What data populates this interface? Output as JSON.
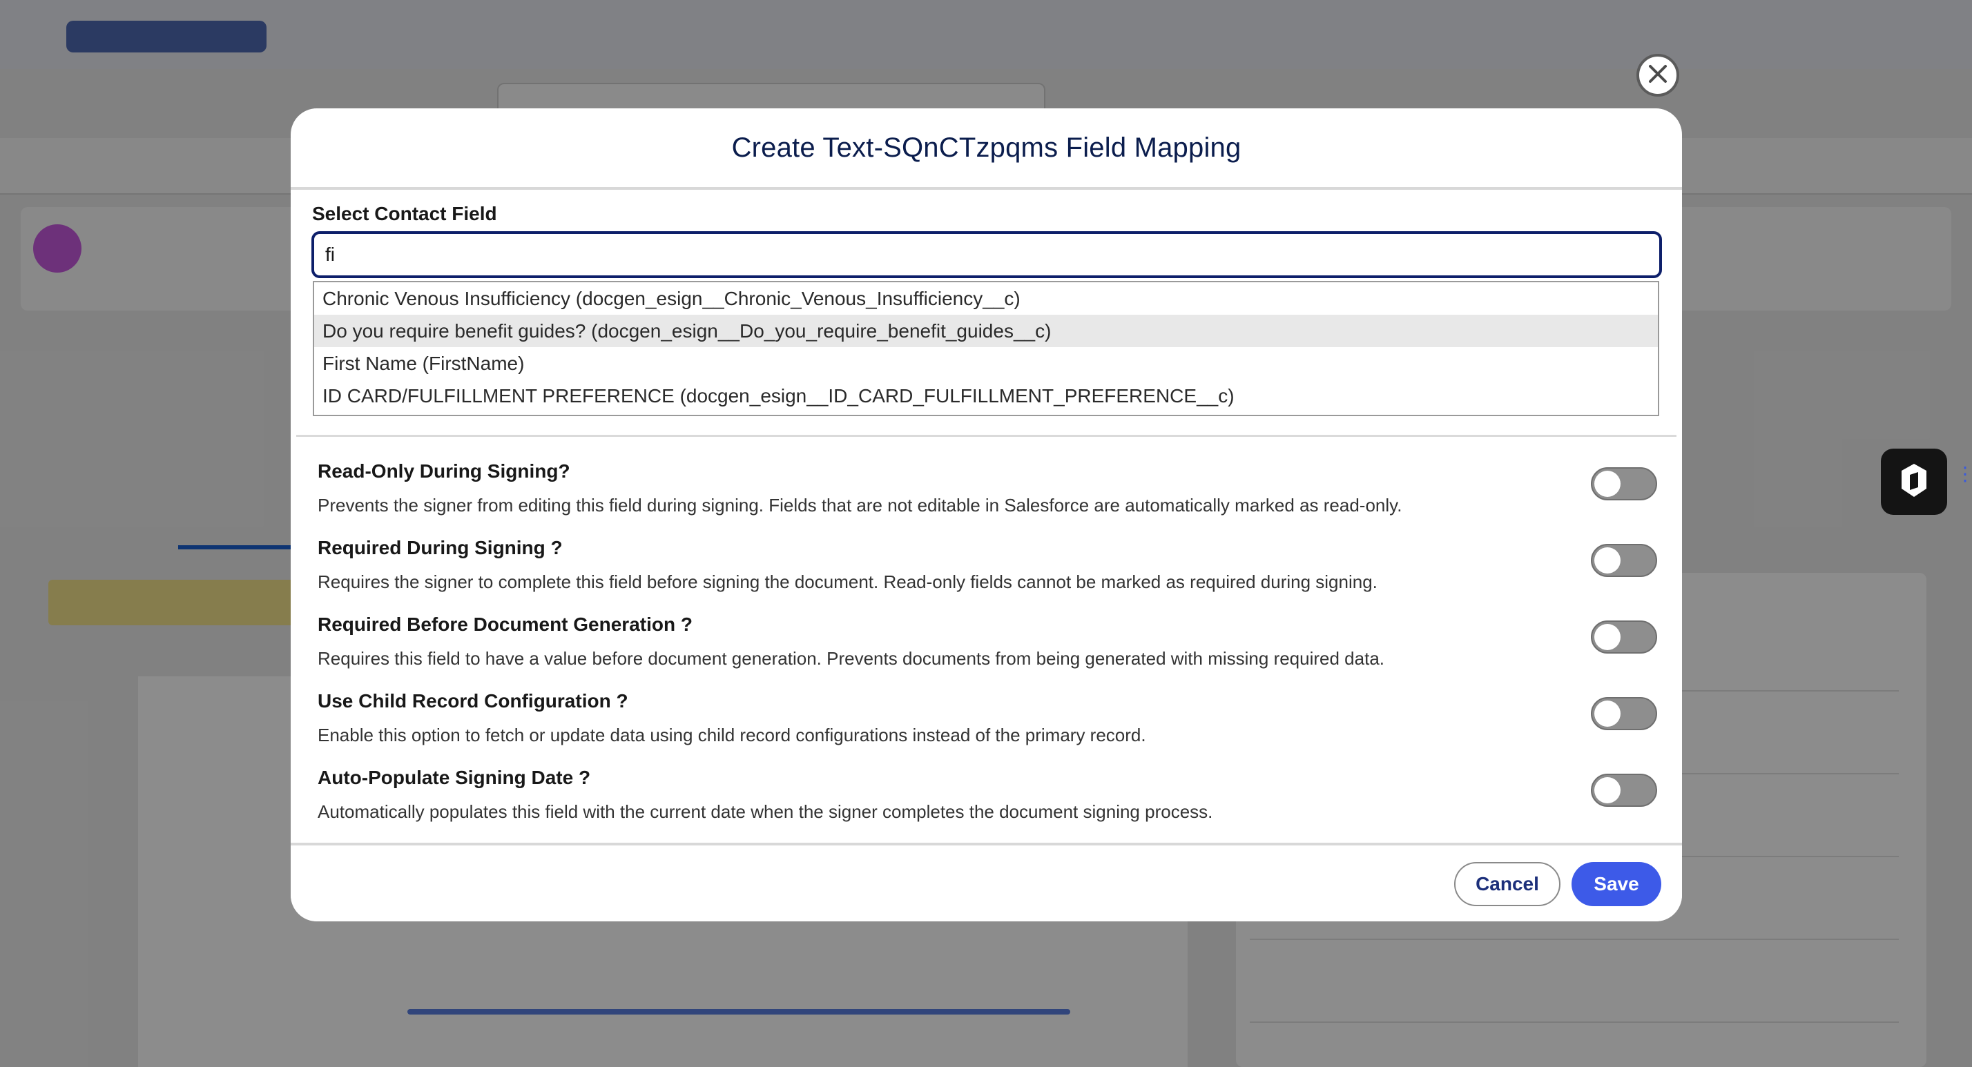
{
  "modal": {
    "title": "Create Text-SQnCTzpqms Field Mapping",
    "field_label": "Select Contact Field",
    "search_value": "fi",
    "dropdown_options": [
      "Chronic Venous Insufficiency (docgen_esign__Chronic_Venous_Insufficiency__c)",
      "Do you require benefit guides? (docgen_esign__Do_you_require_benefit_guides__c)",
      "First Name (FirstName)",
      "ID CARD/FULFILLMENT PREFERENCE (docgen_esign__ID_CARD_FULFILLMENT_PREFERENCE__c)"
    ],
    "highlighted_option_index": 1,
    "options": [
      {
        "title": "Read-Only During Signing?",
        "description": "Prevents the signer from editing this field during signing. Fields that are not editable in Salesforce are automatically marked as read-only.",
        "enabled": false
      },
      {
        "title": "Required During Signing ?",
        "description": "Requires the signer to complete this field before signing the document. Read-only fields cannot be marked as required during signing.",
        "enabled": false
      },
      {
        "title": "Required Before Document Generation ?",
        "description": "Requires this field to have a value before document generation. Prevents documents from being generated with missing required data.",
        "enabled": false
      },
      {
        "title": "Use Child Record Configuration ?",
        "description": "Enable this option to fetch or update data using child record configurations instead of the primary record.",
        "enabled": false
      },
      {
        "title": "Auto-Populate Signing Date ?",
        "description": "Automatically populates this field with the current date when the signer completes the document signing process.",
        "enabled": false
      }
    ],
    "cancel_label": "Cancel",
    "save_label": "Save"
  },
  "icons": {
    "close": "close-icon",
    "side_widget": "shield-icon",
    "drag": "drag-handle-icon"
  },
  "colors": {
    "primary": "#3d5ae8",
    "title": "#0b1d4d",
    "input_border": "#0d1f6a",
    "toggle_off": "#8e8e8e"
  }
}
